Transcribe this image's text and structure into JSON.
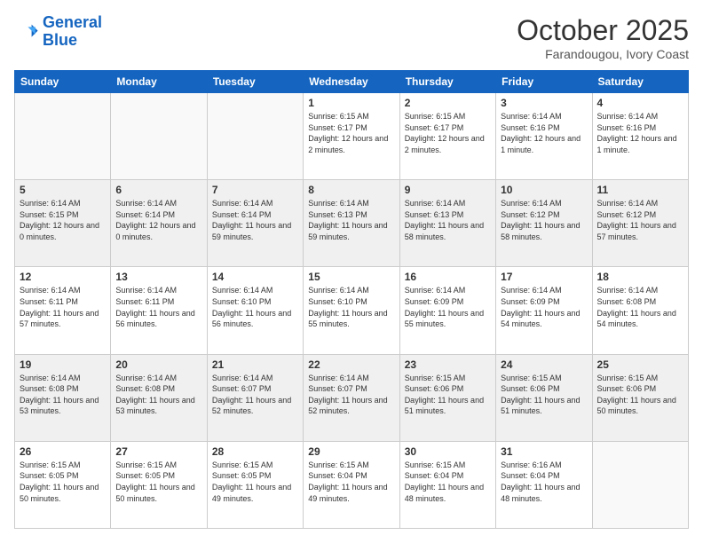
{
  "header": {
    "logo_line1": "General",
    "logo_line2": "Blue",
    "month": "October 2025",
    "location": "Farandougou, Ivory Coast"
  },
  "days_of_week": [
    "Sunday",
    "Monday",
    "Tuesday",
    "Wednesday",
    "Thursday",
    "Friday",
    "Saturday"
  ],
  "weeks": [
    [
      {
        "day": "",
        "info": ""
      },
      {
        "day": "",
        "info": ""
      },
      {
        "day": "",
        "info": ""
      },
      {
        "day": "1",
        "info": "Sunrise: 6:15 AM\nSunset: 6:17 PM\nDaylight: 12 hours and 2 minutes."
      },
      {
        "day": "2",
        "info": "Sunrise: 6:15 AM\nSunset: 6:17 PM\nDaylight: 12 hours and 2 minutes."
      },
      {
        "day": "3",
        "info": "Sunrise: 6:14 AM\nSunset: 6:16 PM\nDaylight: 12 hours and 1 minute."
      },
      {
        "day": "4",
        "info": "Sunrise: 6:14 AM\nSunset: 6:16 PM\nDaylight: 12 hours and 1 minute."
      }
    ],
    [
      {
        "day": "5",
        "info": "Sunrise: 6:14 AM\nSunset: 6:15 PM\nDaylight: 12 hours and 0 minutes."
      },
      {
        "day": "6",
        "info": "Sunrise: 6:14 AM\nSunset: 6:14 PM\nDaylight: 12 hours and 0 minutes."
      },
      {
        "day": "7",
        "info": "Sunrise: 6:14 AM\nSunset: 6:14 PM\nDaylight: 11 hours and 59 minutes."
      },
      {
        "day": "8",
        "info": "Sunrise: 6:14 AM\nSunset: 6:13 PM\nDaylight: 11 hours and 59 minutes."
      },
      {
        "day": "9",
        "info": "Sunrise: 6:14 AM\nSunset: 6:13 PM\nDaylight: 11 hours and 58 minutes."
      },
      {
        "day": "10",
        "info": "Sunrise: 6:14 AM\nSunset: 6:12 PM\nDaylight: 11 hours and 58 minutes."
      },
      {
        "day": "11",
        "info": "Sunrise: 6:14 AM\nSunset: 6:12 PM\nDaylight: 11 hours and 57 minutes."
      }
    ],
    [
      {
        "day": "12",
        "info": "Sunrise: 6:14 AM\nSunset: 6:11 PM\nDaylight: 11 hours and 57 minutes."
      },
      {
        "day": "13",
        "info": "Sunrise: 6:14 AM\nSunset: 6:11 PM\nDaylight: 11 hours and 56 minutes."
      },
      {
        "day": "14",
        "info": "Sunrise: 6:14 AM\nSunset: 6:10 PM\nDaylight: 11 hours and 56 minutes."
      },
      {
        "day": "15",
        "info": "Sunrise: 6:14 AM\nSunset: 6:10 PM\nDaylight: 11 hours and 55 minutes."
      },
      {
        "day": "16",
        "info": "Sunrise: 6:14 AM\nSunset: 6:09 PM\nDaylight: 11 hours and 55 minutes."
      },
      {
        "day": "17",
        "info": "Sunrise: 6:14 AM\nSunset: 6:09 PM\nDaylight: 11 hours and 54 minutes."
      },
      {
        "day": "18",
        "info": "Sunrise: 6:14 AM\nSunset: 6:08 PM\nDaylight: 11 hours and 54 minutes."
      }
    ],
    [
      {
        "day": "19",
        "info": "Sunrise: 6:14 AM\nSunset: 6:08 PM\nDaylight: 11 hours and 53 minutes."
      },
      {
        "day": "20",
        "info": "Sunrise: 6:14 AM\nSunset: 6:08 PM\nDaylight: 11 hours and 53 minutes."
      },
      {
        "day": "21",
        "info": "Sunrise: 6:14 AM\nSunset: 6:07 PM\nDaylight: 11 hours and 52 minutes."
      },
      {
        "day": "22",
        "info": "Sunrise: 6:14 AM\nSunset: 6:07 PM\nDaylight: 11 hours and 52 minutes."
      },
      {
        "day": "23",
        "info": "Sunrise: 6:15 AM\nSunset: 6:06 PM\nDaylight: 11 hours and 51 minutes."
      },
      {
        "day": "24",
        "info": "Sunrise: 6:15 AM\nSunset: 6:06 PM\nDaylight: 11 hours and 51 minutes."
      },
      {
        "day": "25",
        "info": "Sunrise: 6:15 AM\nSunset: 6:06 PM\nDaylight: 11 hours and 50 minutes."
      }
    ],
    [
      {
        "day": "26",
        "info": "Sunrise: 6:15 AM\nSunset: 6:05 PM\nDaylight: 11 hours and 50 minutes."
      },
      {
        "day": "27",
        "info": "Sunrise: 6:15 AM\nSunset: 6:05 PM\nDaylight: 11 hours and 50 minutes."
      },
      {
        "day": "28",
        "info": "Sunrise: 6:15 AM\nSunset: 6:05 PM\nDaylight: 11 hours and 49 minutes."
      },
      {
        "day": "29",
        "info": "Sunrise: 6:15 AM\nSunset: 6:04 PM\nDaylight: 11 hours and 49 minutes."
      },
      {
        "day": "30",
        "info": "Sunrise: 6:15 AM\nSunset: 6:04 PM\nDaylight: 11 hours and 48 minutes."
      },
      {
        "day": "31",
        "info": "Sunrise: 6:16 AM\nSunset: 6:04 PM\nDaylight: 11 hours and 48 minutes."
      },
      {
        "day": "",
        "info": ""
      }
    ]
  ]
}
